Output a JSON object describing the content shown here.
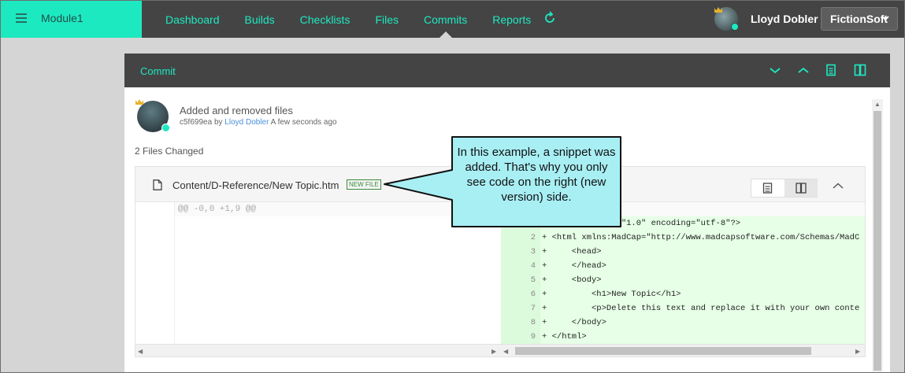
{
  "app": {
    "module_name": "Module1",
    "user_name": "Lloyd Dobler",
    "company": "FictionSoft",
    "accent_color": "#1de9c1",
    "header_color": "#444444"
  },
  "nav": {
    "items": [
      "Dashboard",
      "Builds",
      "Checklists",
      "Files",
      "Commits",
      "Reports"
    ],
    "active": "Commits",
    "refresh_icon": "refresh-icon"
  },
  "panel": {
    "title": "Commit",
    "header_icons": [
      "chevron-down-icon",
      "chevron-up-icon",
      "unified-view-icon",
      "split-view-icon"
    ]
  },
  "commit": {
    "message": "Added and removed files",
    "hash": "c5f699ea",
    "by_text": "by",
    "author": "Lloyd Dobler",
    "time": "A few seconds ago",
    "files_changed": "2 Files Changed"
  },
  "file": {
    "path": "Content/D-Reference/New Topic.htm",
    "badge": "NEW FILE",
    "hunk": "@@ -0,0 +1,9 @@",
    "lines": [
      {
        "n": "1",
        "text": "+ <?xml version=\"1.0\" encoding=\"utf-8\"?>"
      },
      {
        "n": "2",
        "text": "+ <html xmlns:MadCap=\"http://www.madcapsoftware.com/Schemas/MadC"
      },
      {
        "n": "3",
        "text": "+     <head>"
      },
      {
        "n": "4",
        "text": "+     </head>"
      },
      {
        "n": "5",
        "text": "+     <body>"
      },
      {
        "n": "6",
        "text": "+         <h1>New Topic</h1>"
      },
      {
        "n": "7",
        "text": "+         <p>Delete this text and replace it with your own conte"
      },
      {
        "n": "8",
        "text": "+     </body>"
      },
      {
        "n": "9",
        "text": "+ </html>"
      }
    ]
  },
  "callout": {
    "text": "In this example, a snippet was added. That's why you only see code on the right (new version) side.",
    "fill": "#a8eff4",
    "stroke": "#111111"
  }
}
